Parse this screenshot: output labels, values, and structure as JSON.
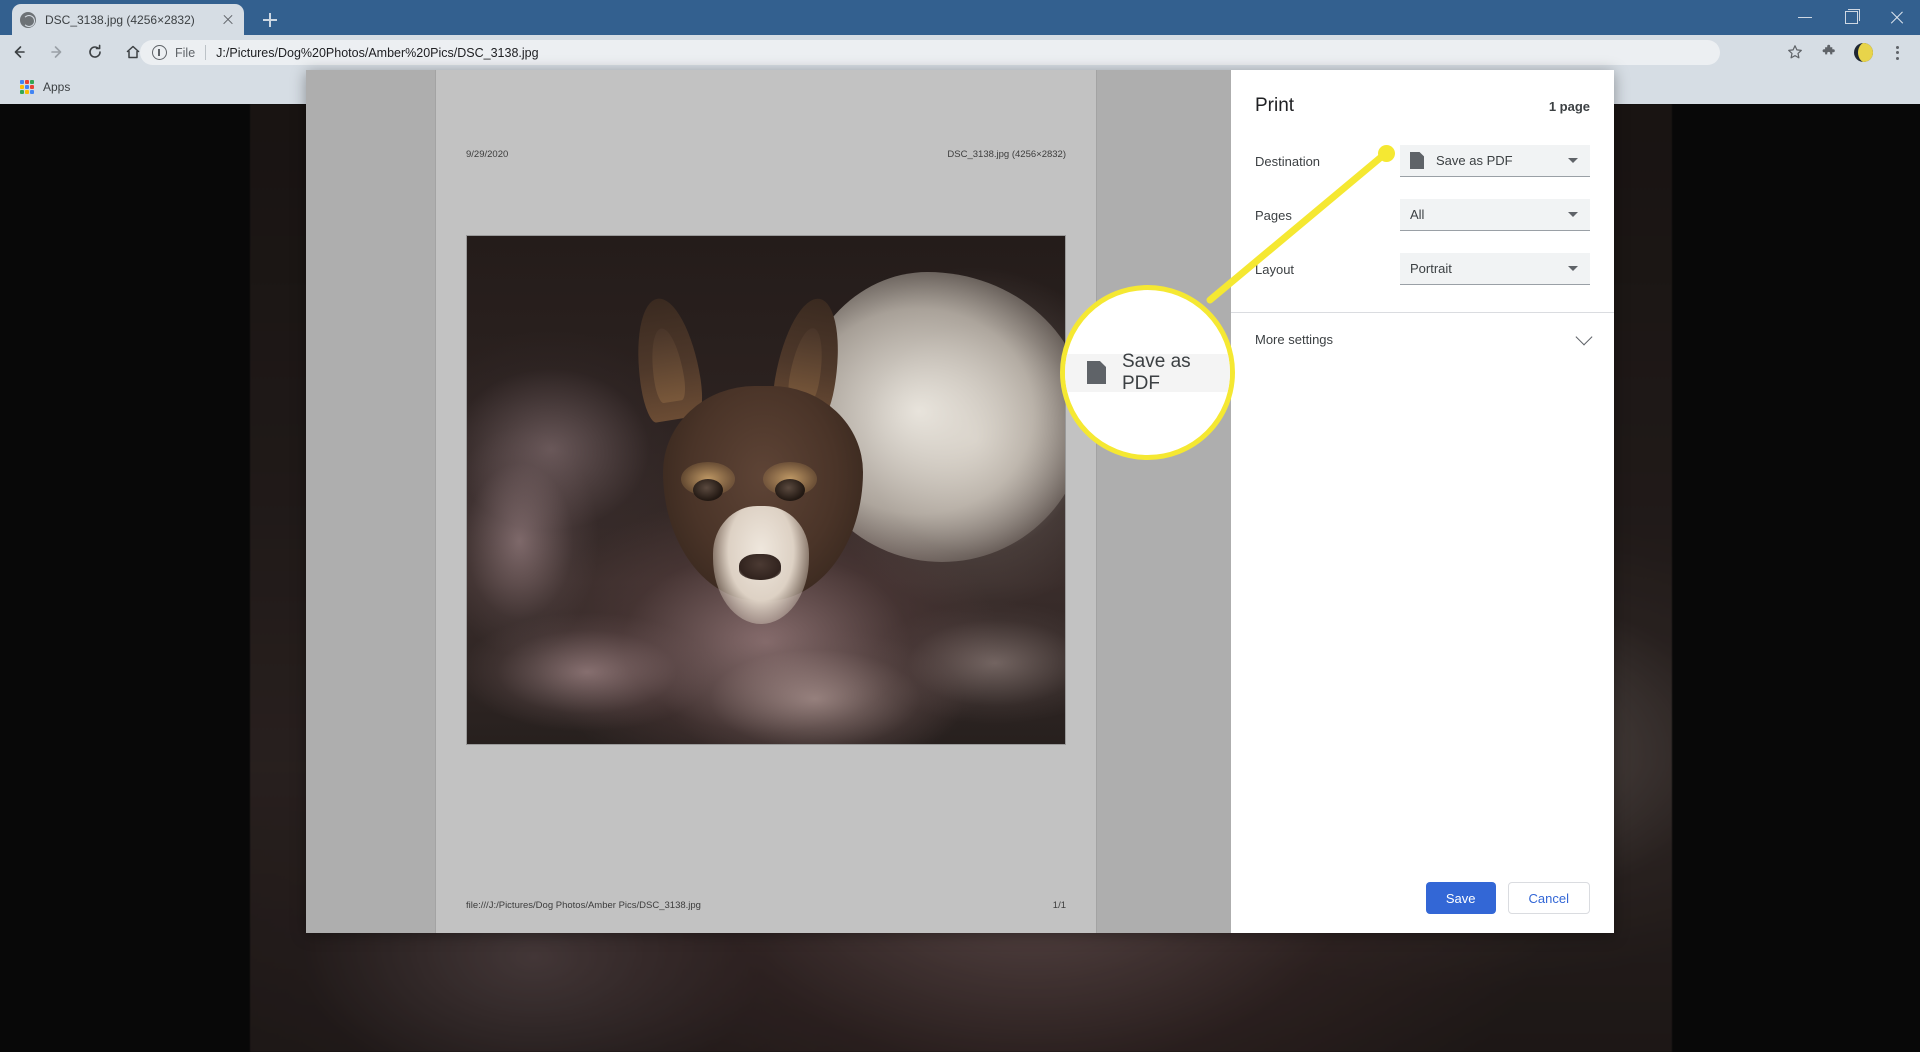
{
  "browser": {
    "tab": {
      "title": "DSC_3138.jpg (4256×2832)",
      "favicon": "globe-icon",
      "close": "close-icon"
    },
    "new_tab_label": "+",
    "window_controls": {
      "minimize": "minimize-icon",
      "maximize": "restore-icon",
      "close": "close-icon"
    },
    "toolbar": {
      "back": "back-arrow-icon",
      "forward": "forward-arrow-icon",
      "reload": "reload-icon",
      "home": "home-icon",
      "omnibox": {
        "security_icon": "info-circle-icon",
        "scheme": "File",
        "url": "J:/Pictures/Dog%20Photos/Amber%20Pics/DSC_3138.jpg"
      },
      "bookmark_star": "star-icon",
      "extensions": "puzzle-icon",
      "profile": "avatar-icon",
      "menu": "kebab-menu-icon"
    },
    "bookmarks": [
      {
        "label": "Apps",
        "icon": "apps-grid-icon"
      }
    ]
  },
  "print_dialog": {
    "preview": {
      "header_left": "9/29/2020",
      "header_right": "DSC_3138.jpg (4256×2832)",
      "footer_left": "file:///J:/Pictures/Dog Photos/Amber Pics/DSC_3138.jpg",
      "footer_right": "1/1",
      "photo_alt": "Small tricolor rat terrier dog lying on a floral quilt"
    },
    "title": "Print",
    "page_count": "1 page",
    "settings": [
      {
        "label": "Destination",
        "value": "Save as PDF",
        "icon": "pdf-document-icon"
      },
      {
        "label": "Pages",
        "value": "All",
        "icon": ""
      },
      {
        "label": "Layout",
        "value": "Portrait",
        "icon": ""
      }
    ],
    "more_settings_label": "More settings",
    "buttons": {
      "save": "Save",
      "cancel": "Cancel"
    }
  },
  "callout": {
    "magnified_text": "Save as PDF",
    "icon": "pdf-document-icon",
    "color": "#f5e832"
  },
  "colors": {
    "titlebar": "#33608f",
    "toolbar": "#d6dde4",
    "accent": "#3367d6",
    "callout": "#f5e832",
    "paper": "#c2c2c2",
    "preview_bg": "#aeaeae"
  }
}
